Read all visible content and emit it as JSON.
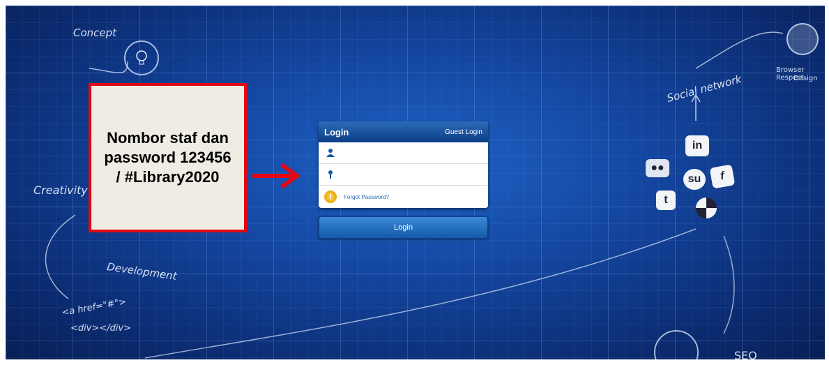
{
  "background": {
    "labels": {
      "concept": "Concept",
      "creativity": "Creativity",
      "development": "Development",
      "code_line1": "<a href=\"#\">",
      "code_line2": "<div></div>",
      "social_network": "Social network",
      "browser_respect": "Browser Respect",
      "design": "Design",
      "seo": "SEO"
    }
  },
  "annotation": {
    "text": "Nombor staf dan password 123456 / #Library2020",
    "border_color": "#e30613"
  },
  "login_panel": {
    "title": "Login",
    "guest_login": "Guest Login",
    "username": {
      "value": "",
      "placeholder": ""
    },
    "password": {
      "value": "",
      "placeholder": ""
    },
    "forgot_password": "Forgot Password?",
    "login_button": "Login"
  },
  "social_icons": {
    "linkedin": "in",
    "stumbleupon": "su",
    "facebook": "f",
    "twitter": "t"
  }
}
